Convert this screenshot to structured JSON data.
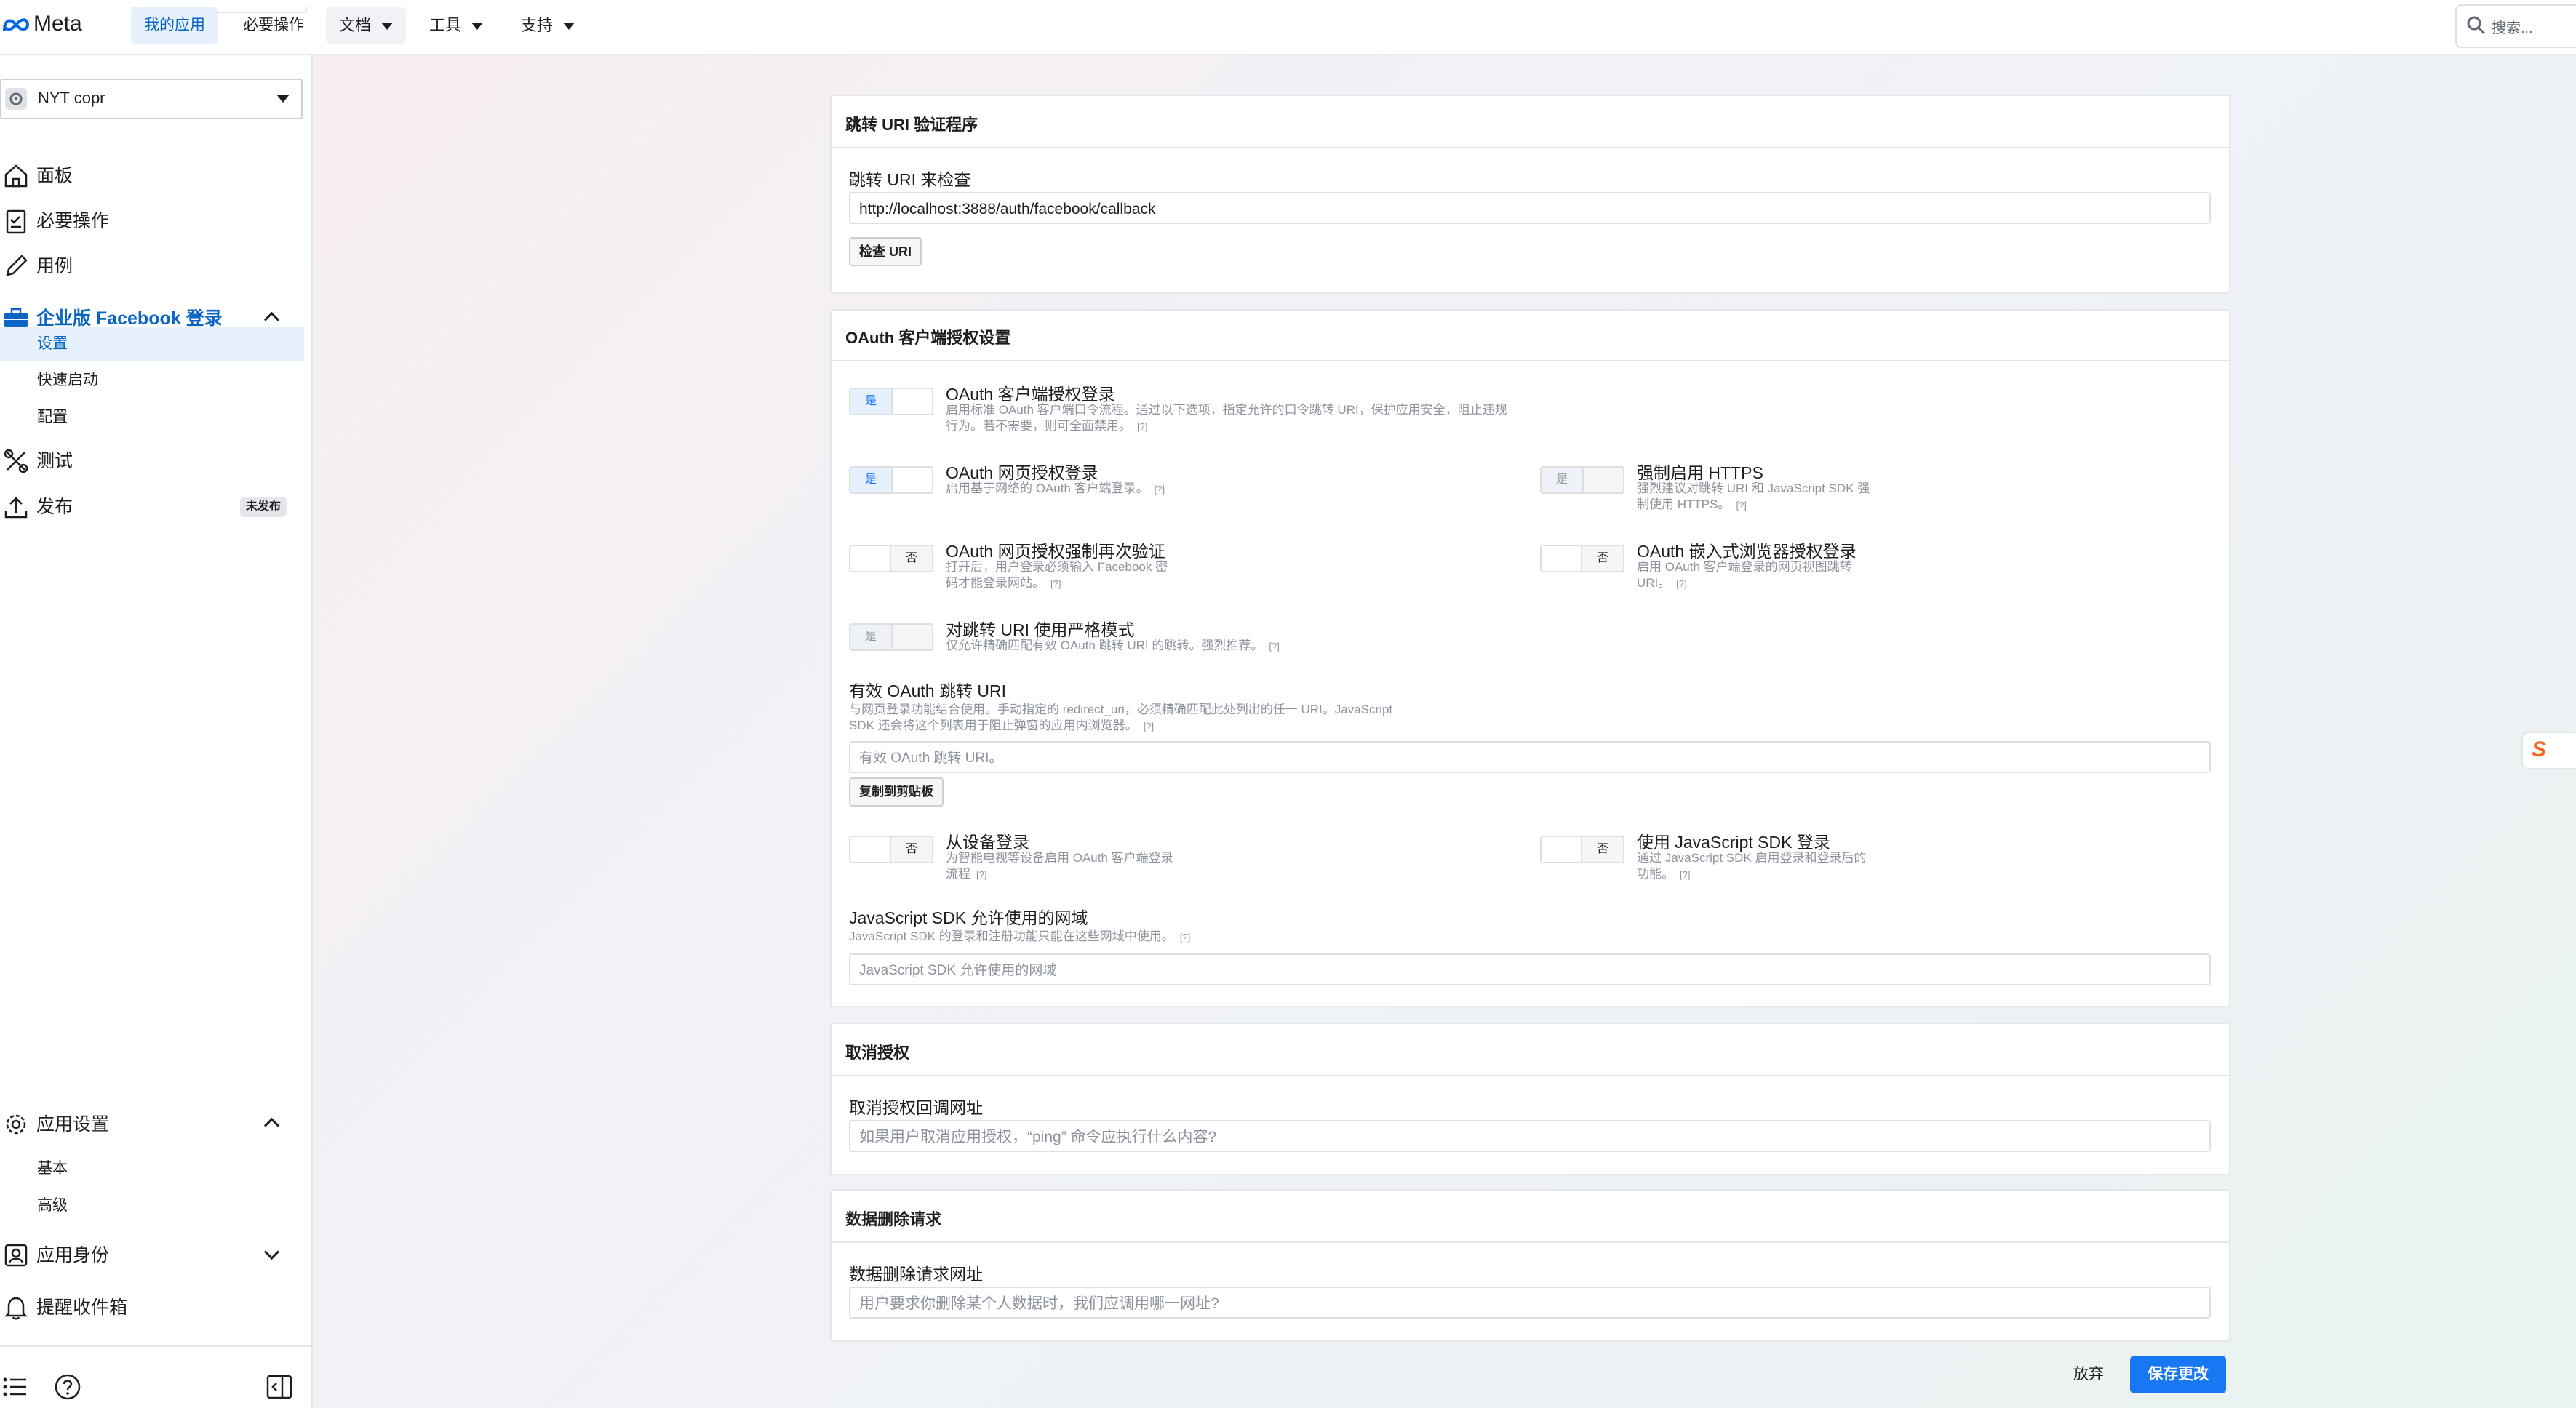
{
  "topbar": {
    "brand": "Meta",
    "nav": [
      "我的应用",
      "必要操作"
    ],
    "menus": [
      "文档",
      "工具",
      "支持"
    ],
    "search_placeholder": "搜索..."
  },
  "sidebar": {
    "app_name": "NYT copr",
    "items": [
      {
        "label": "面板",
        "icon": "home-icon"
      },
      {
        "label": "必要操作",
        "icon": "clipboard-icon"
      },
      {
        "label": "用例",
        "icon": "pencil-icon"
      },
      {
        "label": "企业版 Facebook 登录",
        "icon": "briefcase-icon"
      },
      {
        "label": "测试",
        "icon": "tools-icon"
      },
      {
        "label": "发布",
        "icon": "upload-icon",
        "badge": "未发布"
      }
    ],
    "login_subitems": [
      "设置",
      "快速启动",
      "配置"
    ],
    "app_settings": {
      "label": "应用设置",
      "subitems": [
        "基本",
        "高级"
      ]
    },
    "app_roles": "应用身份",
    "alerts": "提醒收件箱",
    "accent": "#0a66c2"
  },
  "redirect_validator": {
    "title": "跳转 URI 验证程序",
    "label": "跳转 URI 来检查",
    "value": "http://localhost:3888/auth/facebook/callback",
    "button": "检查 URI"
  },
  "oauth": {
    "title": "OAuth 客户端授权设置",
    "yes": "是",
    "no": "否",
    "help": "[?]",
    "client_login": {
      "label": "OAuth 客户端授权登录",
      "desc1": "启用标准 OAuth 客户端口令流程。通过以下选项，指定允许的口令跳转 URI，保护应用安全，阻止违规",
      "desc2": "行为。若不需要，则可全面禁用。",
      "on": true
    },
    "web_login": {
      "label": "OAuth 网页授权登录",
      "desc1": "启用基于网络的 OAuth 客户端登录。",
      "on": true
    },
    "https": {
      "label": "强制启用 HTTPS",
      "desc1": "强烈建议对跳转 URI 和 JavaScript SDK 强",
      "desc2": "制使用 HTTPS。",
      "on": true
    },
    "reauth": {
      "label": "OAuth 网页授权强制再次验证",
      "desc1": "打开后，用户登录必须输入 Facebook 密",
      "desc2": "码才能登录网站。",
      "on": false
    },
    "embedded": {
      "label": "OAuth 嵌入式浏览器授权登录",
      "desc1": "启用 OAuth 客户端登录的网页视图跳转",
      "desc2": "URI。",
      "on": false
    },
    "strict": {
      "label": "对跳转 URI 使用严格模式",
      "desc1": "仅允许精确匹配有效 OAuth 跳转 URI 的跳转。强烈推荐。",
      "on": true
    },
    "valid_uris": {
      "label": "有效 OAuth 跳转 URI",
      "desc1": "与网页登录功能结合使用。手动指定的 redirect_uri，必须精确匹配此处列出的任一 URI。JavaScript",
      "desc2": "SDK 还会将这个列表用于阻止弹窗的应用内浏览器。",
      "placeholder": "有效 OAuth 跳转 URI。",
      "copy_button": "复制到剪贴板"
    },
    "device": {
      "label": "从设备登录",
      "desc1": "为智能电视等设备启用 OAuth 客户端登录",
      "desc2": "流程",
      "on": false
    },
    "jssdk": {
      "label": "使用 JavaScript SDK 登录",
      "desc1": "通过 JavaScript SDK 启用登录和登录后的",
      "desc2": "功能。",
      "on": false
    },
    "domains": {
      "label": "JavaScript SDK 允许使用的网域",
      "desc1": "JavaScript SDK 的登录和注册功能只能在这些网域中使用。",
      "placeholder": "JavaScript SDK 允许使用的网域"
    }
  },
  "deauth": {
    "title": "取消授权",
    "label": "取消授权回调网址",
    "placeholder": "如果用户取消应用授权，“ping” 命令应执行什么内容?"
  },
  "data_deletion": {
    "title": "数据删除请求",
    "label": "数据删除请求网址",
    "placeholder": "用户要求你删除某个人数据时，我们应调用哪一网址?"
  },
  "footer": {
    "discard": "放弃",
    "save": "保存更改"
  }
}
